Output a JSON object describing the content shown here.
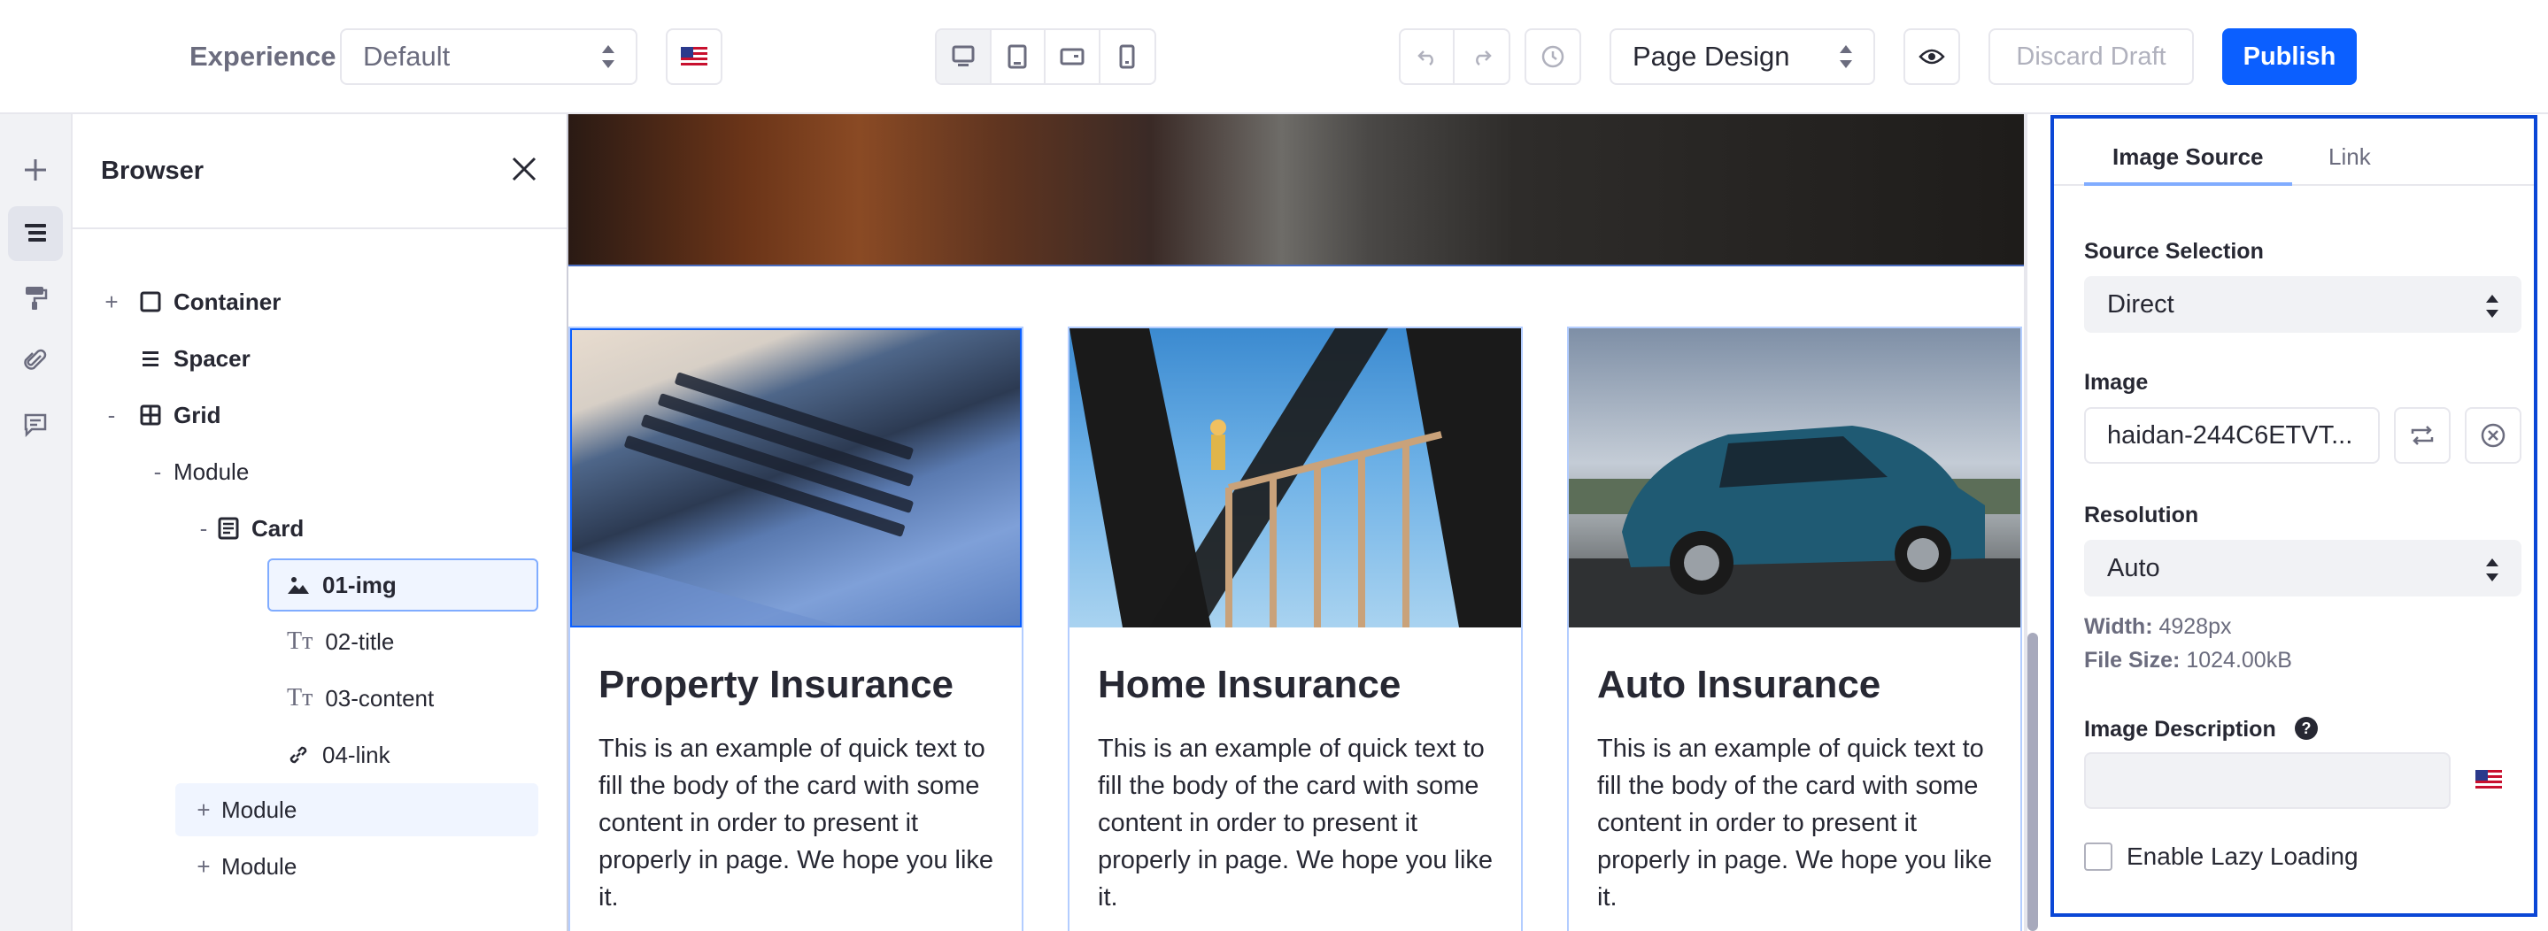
{
  "topbar": {
    "experience_label": "Experience",
    "experience_value": "Default",
    "mode_value": "Page Design",
    "discard_label": "Discard Draft",
    "publish_label": "Publish",
    "accent_color": "#0b5fff"
  },
  "rail": {
    "items": [
      "add-icon",
      "page-structure-icon",
      "paint-brush-icon",
      "paperclip-icon",
      "comment-icon"
    ]
  },
  "browser": {
    "title": "Browser",
    "tree": [
      {
        "label": "Container",
        "expander": "+"
      },
      {
        "label": "Spacer",
        "expander": ""
      },
      {
        "label": "Grid",
        "expander": "-"
      },
      {
        "label": "Module",
        "expander": "-"
      },
      {
        "label": "Card",
        "expander": "-"
      },
      {
        "label": "01-img",
        "expander": ""
      },
      {
        "label": "02-title",
        "expander": ""
      },
      {
        "label": "03-content",
        "expander": ""
      },
      {
        "label": "04-link",
        "expander": ""
      },
      {
        "label": "Module",
        "expander": "+"
      },
      {
        "label": "Module",
        "expander": "+"
      }
    ]
  },
  "cards": [
    {
      "title": "Property Insurance",
      "body": "This is an example of quick text to fill the body of the card with some content in order to present it properly in page. We hope you like it."
    },
    {
      "title": "Home Insurance",
      "body": "This is an example of quick text to fill the body of the card with some content in order to present it properly in page. We hope you like it."
    },
    {
      "title": "Auto Insurance",
      "body": "This is an example of quick text to fill the body of the card with some content in order to present it properly in page. We hope you like it."
    }
  ],
  "sidebar": {
    "tabs": [
      "Image Source",
      "Link"
    ],
    "source_selection_label": "Source Selection",
    "source_selection_value": "Direct",
    "image_label": "Image",
    "image_value": "haidan-244C6ETVT...",
    "resolution_label": "Resolution",
    "resolution_value": "Auto",
    "width_label": "Width:",
    "width_value": "4928px",
    "filesize_label": "File Size:",
    "filesize_value": "1024.00kB",
    "description_label": "Image Description",
    "lazy_label": "Enable Lazy Loading"
  }
}
